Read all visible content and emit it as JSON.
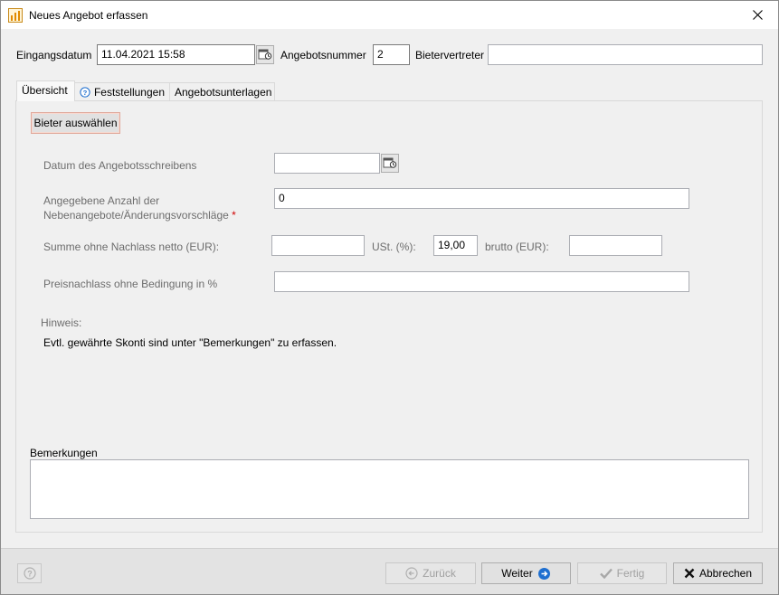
{
  "window": {
    "title": "Neues Angebot erfassen"
  },
  "header": {
    "eingangsdatum_label": "Eingangsdatum",
    "eingangsdatum_value": "11.04.2021 15:58",
    "angebotsnummer_label": "Angebotsnummer",
    "angebotsnummer_value": "2",
    "bietervertreter_label": "Bietervertreter",
    "bietervertreter_value": ""
  },
  "tabs": [
    {
      "label": "Übersicht",
      "active": true
    },
    {
      "label": "Feststellungen",
      "icon": "help-circle-icon"
    },
    {
      "label": "Angebotsunterlagen"
    }
  ],
  "form": {
    "bieter_button": "Bieter auswählen",
    "datum_label": "Datum des Angebotsschreibens",
    "datum_value": "",
    "anzahl_label_line1": "Angegebene Anzahl der",
    "anzahl_label_line2": "Nebenangebote/Änderungsvorschläge",
    "anzahl_required": "*",
    "anzahl_value": "0",
    "summe_label": "Summe ohne Nachlass netto (EUR):",
    "summe_value": "",
    "ust_label": "USt. (%):",
    "ust_value": "19,00",
    "brutto_label": "brutto (EUR):",
    "brutto_value": "",
    "preisnachlass_label": "Preisnachlass ohne Bedingung in %",
    "preisnachlass_value": "",
    "hinweis_label": "Hinweis:",
    "hinweis_text": "Evtl. gewährte Skonti sind unter \"Bemerkungen\" zu erfassen.",
    "bemerkungen_label": "Bemerkungen",
    "bemerkungen_value": ""
  },
  "footer": {
    "zurueck_label": "Zurück",
    "weiter_label": "Weiter",
    "fertig_label": "Fertig",
    "abbrechen_label": "Abbrechen"
  },
  "colors": {
    "accent_blue": "#1e6fd0",
    "disabled": "#a0a0a0",
    "required": "#d00000"
  }
}
